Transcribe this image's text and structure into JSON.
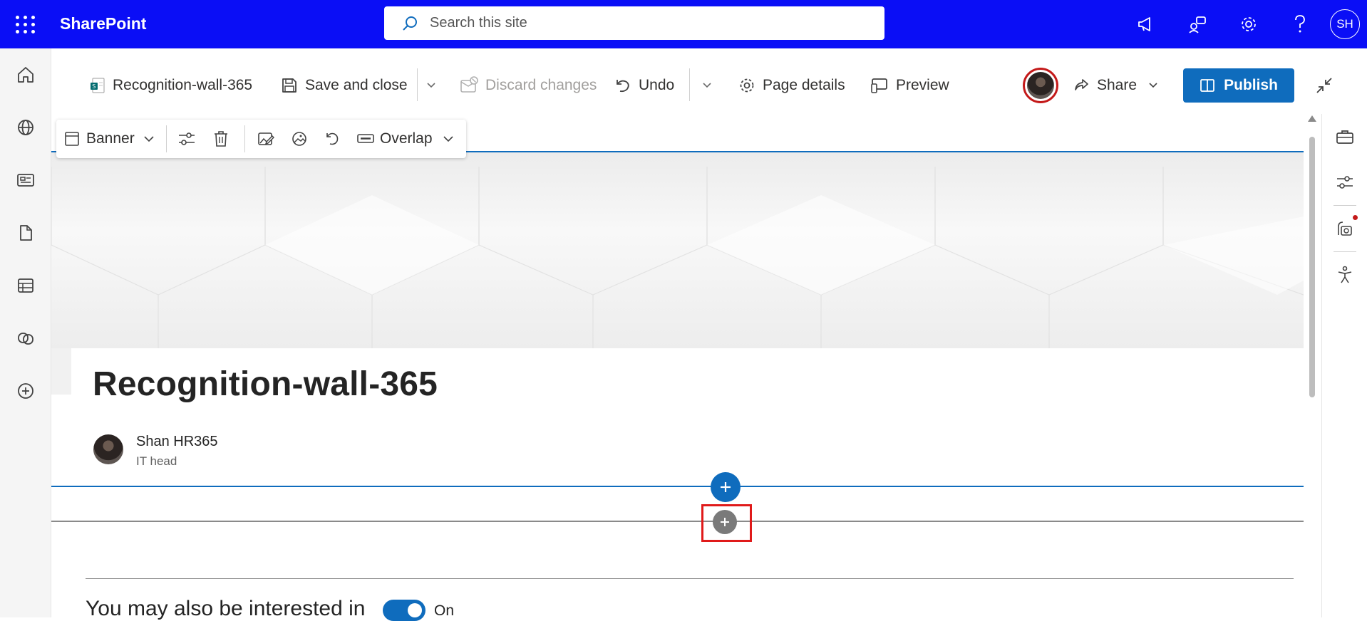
{
  "suite_bar": {
    "app_name": "SharePoint",
    "search_placeholder": "Search this site",
    "user_initials": "SH"
  },
  "command_bar": {
    "page_name": "Recognition-wall-365",
    "save_close": "Save and close",
    "discard": "Discard changes",
    "undo": "Undo",
    "page_details": "Page details",
    "preview": "Preview",
    "share": "Share",
    "publish": "Publish"
  },
  "banner_toolbar": {
    "layout": "Banner",
    "text_alignment": "Overlap"
  },
  "page": {
    "title": "Recognition-wall-365",
    "author_name": "Shan HR365",
    "author_role": "IT head"
  },
  "bottom": {
    "heading": "You may also be interested in",
    "toggle_label": "On",
    "toggle_on": true
  },
  "colors": {
    "suite_bar": "#0a0ef6",
    "accent": "#0f6cbd",
    "highlight": "#e01a1a"
  },
  "icons": {
    "left_nav": [
      "home-icon",
      "globe-icon",
      "news-icon",
      "document-icon",
      "list-icon",
      "link-icon",
      "add-circle-icon"
    ],
    "right_rail": [
      "toolbox-icon",
      "settings-sliders-icon",
      "design-ideas-icon",
      "accessibility-icon"
    ]
  }
}
